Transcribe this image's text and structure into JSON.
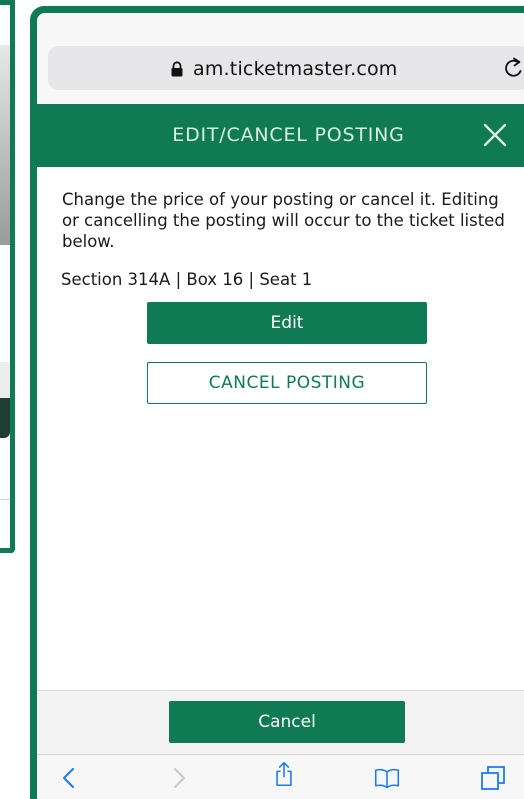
{
  "browser": {
    "url": "am.ticketmaster.com",
    "lock_icon": "lock-icon",
    "reload_icon": "reload-icon"
  },
  "modal": {
    "title": "EDIT/CANCEL POSTING",
    "close_icon": "close-icon",
    "description": "Change the price of your posting or cancel it. Editing or cancelling the posting will occur to the ticket listed below.",
    "ticket_info": "Section 314A | Box 16 | Seat 1",
    "edit_label": "Edit",
    "cancel_posting_label": "CANCEL POSTING"
  },
  "footer": {
    "cancel_label": "Cancel"
  },
  "toolbar": {
    "icons": [
      "back-icon",
      "forward-icon",
      "share-icon",
      "bookmarks-icon",
      "tabs-icon"
    ]
  },
  "colors": {
    "brand_green": "#0f7a53",
    "ios_blue": "#1a7cf5"
  }
}
